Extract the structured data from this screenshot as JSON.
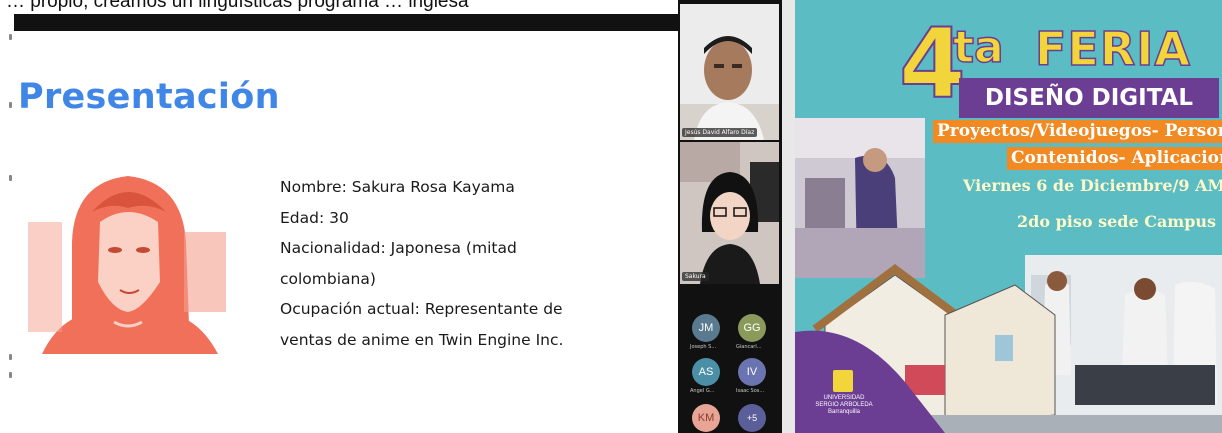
{
  "caption": {
    "text": "… propio, creamos un lingüísticas programa … inglesa"
  },
  "slide": {
    "title": "Presentación",
    "info_lines": [
      "Nombre: Sakura Rosa Kayama",
      "Edad: 30",
      "Nacionalidad: Japonesa (mitad",
      "colombiana)",
      "Ocupación actual: Representante de",
      "ventas de anime en Twin Engine Inc."
    ],
    "colors": {
      "title": "#3f86e6",
      "portrait_tint": "#f0705a"
    }
  },
  "participants": {
    "videos": [
      {
        "name": "Jesús David Alfaro Díaz"
      },
      {
        "name": "Sakura"
      }
    ],
    "avatars": [
      {
        "initials": "JM",
        "label": "Joseph S...",
        "color": "#5a7a8f"
      },
      {
        "initials": "GG",
        "label": "Giancarl...",
        "color": "#8a9a5b"
      },
      {
        "initials": "AS",
        "label": "Angel G...",
        "color": "#4a8fa6"
      },
      {
        "initials": "IV",
        "label": "Isaac Sos...",
        "color": "#6a74b0"
      },
      {
        "initials": "KM",
        "label": "",
        "color": "#e8a596"
      },
      {
        "initials": "+5",
        "label": "",
        "color": "#5a5f9a"
      }
    ]
  },
  "poster": {
    "number": "4",
    "superscript": "ta",
    "title": "FERIA",
    "subtitle": "DISEÑO DIGITAL",
    "line1": "Proyectos/Videojuegos- Personajes",
    "line2": "Contenidos- Aplicaciones",
    "date": "Viernes 6 de Diciembre/9 AM",
    "place": "2do piso sede Campus",
    "university": [
      "UNIVERSIDAD",
      "SERGIO ARBOLEDA",
      "Barranquilla"
    ],
    "colors": {
      "bg": "#5bbcc4",
      "yellow": "#f2d43b",
      "purple": "#6b3d93",
      "orange": "#f18a22"
    }
  }
}
